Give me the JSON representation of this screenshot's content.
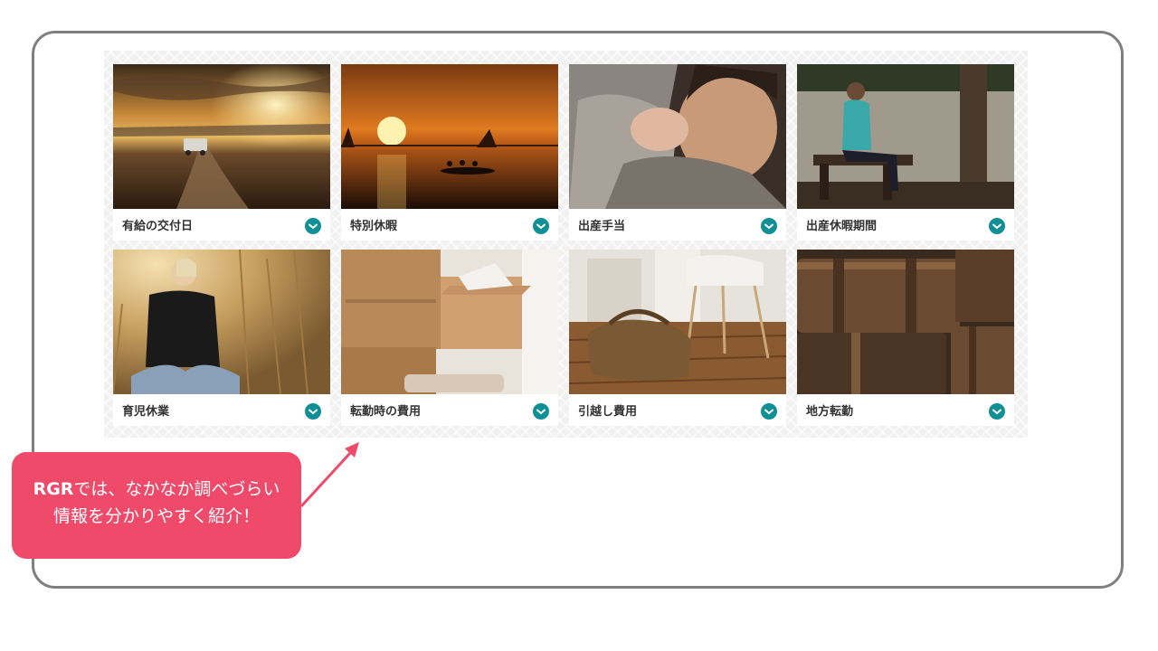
{
  "cards": [
    {
      "label": "有給の交付日",
      "icon": "chevron-down-icon"
    },
    {
      "label": "特別休暇",
      "icon": "chevron-down-icon"
    },
    {
      "label": "出産手当",
      "icon": "chevron-down-icon"
    },
    {
      "label": "出産休暇期間",
      "icon": "chevron-down-icon"
    },
    {
      "label": "育児休業",
      "icon": "chevron-down-icon"
    },
    {
      "label": "転勤時の費用",
      "icon": "chevron-down-icon"
    },
    {
      "label": "引越し費用",
      "icon": "chevron-down-icon"
    },
    {
      "label": "地方転勤",
      "icon": "chevron-down-icon"
    }
  ],
  "callout": {
    "brand": "RGR",
    "line1_rest": "では、なかなか調べづらい",
    "line2": "情報を分かりやすく紹介！"
  },
  "colors": {
    "accent_teal": "#0f8f96",
    "callout_pink": "#ef4a6a",
    "frame_gray": "#7f7f7f"
  }
}
